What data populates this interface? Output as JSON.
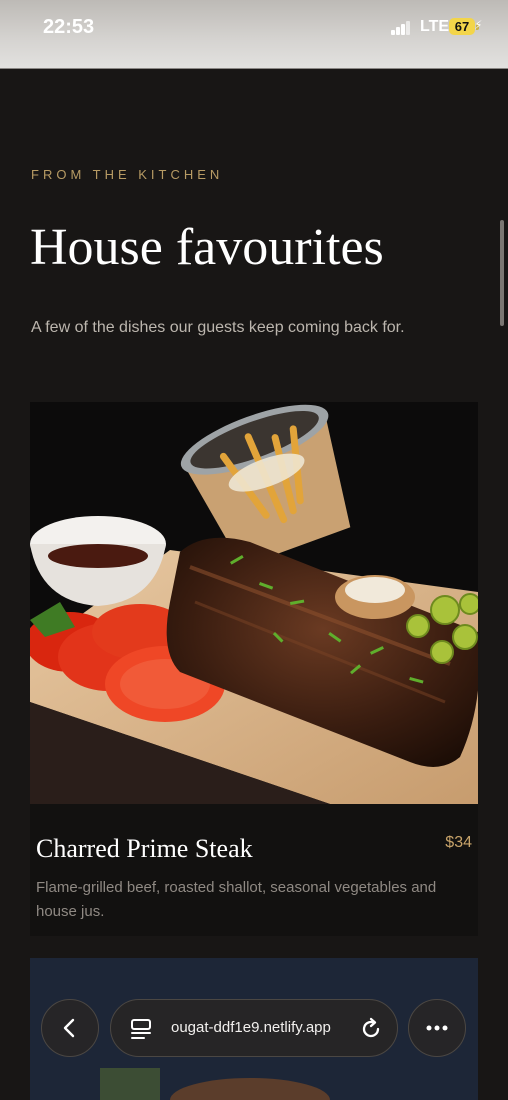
{
  "status": {
    "time": "22:53",
    "network": "LTE",
    "battery": "67"
  },
  "section": {
    "eyebrow": "FROM THE KITCHEN",
    "title": "House favourites",
    "subtitle": "A few of the dishes our guests keep coming back for."
  },
  "dish": {
    "name": "Charred Prime Steak",
    "price": "$34",
    "description": "Flame-grilled beef, roasted shallot, seasonal vegetables and house jus.",
    "image_icon": "ribs-platter-photo"
  },
  "browser": {
    "url": "ougat-ddf1e9.netlify.app"
  },
  "colors": {
    "accent": "#b79b64",
    "price": "#c8a46a",
    "background": "#181615"
  }
}
